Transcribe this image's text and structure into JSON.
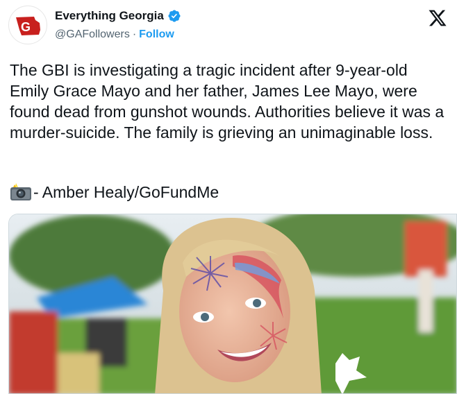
{
  "account": {
    "display_name": "Everything Georgia",
    "handle": "@GAFollowers",
    "separator": "·",
    "follow_label": "Follow",
    "avatar_text": "G"
  },
  "tweet": {
    "text": "The GBI is investigating a tragic incident after 9-year-old Emily Grace Mayo and her father, James Lee Mayo, were found dead from gunshot wounds. Authorities believe it was a murder-suicide. The family is grieving an unimaginable loss.",
    "credit": "- Amber Healy/GoFundMe"
  },
  "icons": {
    "verified": "verified-badge-icon",
    "x_logo": "x-logo-icon",
    "camera": "camera-flash-icon"
  },
  "colors": {
    "link": "#1d9bf0",
    "secondary_text": "#536471",
    "avatar_red": "#c8201e"
  }
}
